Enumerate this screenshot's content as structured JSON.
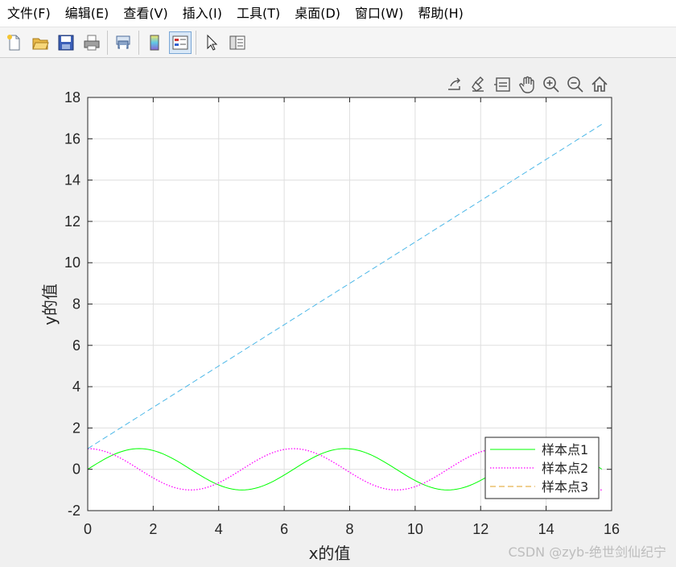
{
  "menu": [
    {
      "label": "文件(F)"
    },
    {
      "label": "编辑(E)"
    },
    {
      "label": "查看(V)"
    },
    {
      "label": "插入(I)"
    },
    {
      "label": "工具(T)"
    },
    {
      "label": "桌面(D)"
    },
    {
      "label": "窗口(W)"
    },
    {
      "label": "帮助(H)"
    }
  ],
  "toolbar": {
    "icons": [
      "new-file-icon",
      "open-folder-icon",
      "save-icon",
      "print-icon",
      "print-preview-icon",
      "colorbar-icon",
      "legend-icon",
      "pointer-icon",
      "property-editor-icon"
    ]
  },
  "axes_toolbar": {
    "icons": [
      "export-icon",
      "brush-icon",
      "data-tips-icon",
      "pan-icon",
      "zoom-in-icon",
      "zoom-out-icon",
      "home-icon"
    ]
  },
  "chart_data": {
    "type": "line",
    "xlabel": "x的值",
    "ylabel": "y的值",
    "xlim": [
      0,
      16
    ],
    "ylim": [
      -2,
      18
    ],
    "xticks": [
      0,
      2,
      4,
      6,
      8,
      10,
      12,
      14,
      16
    ],
    "yticks": [
      -2,
      0,
      2,
      4,
      6,
      8,
      10,
      12,
      14,
      16,
      18
    ],
    "grid": true,
    "legend_position": "bottom-right",
    "x_range": [
      0,
      15.7
    ],
    "series": [
      {
        "name": "样本点1",
        "function": "sin(x)",
        "color": "#00ff00",
        "style": "solid",
        "x": [
          0,
          1.57,
          3.14,
          4.71,
          6.28,
          7.85,
          9.42,
          11.0,
          12.57,
          14.14,
          15.7
        ],
        "y": [
          0,
          1,
          0,
          -1,
          0,
          1,
          0,
          -1,
          0,
          1,
          0
        ]
      },
      {
        "name": "样本点2",
        "function": "cos(x)",
        "color": "#ff00ff",
        "style": "dotted",
        "x": [
          0,
          1.57,
          3.14,
          4.71,
          6.28,
          7.85,
          9.42,
          11.0,
          12.57,
          14.14,
          15.7
        ],
        "y": [
          1,
          0,
          -1,
          0,
          1,
          0,
          -1,
          0,
          1,
          0,
          -1
        ]
      },
      {
        "name": "样本点3",
        "function": "x+1",
        "color": "#4db8e8",
        "style": "dashed",
        "x": [
          0,
          15.7
        ],
        "y": [
          1,
          16.7
        ]
      }
    ],
    "legend_colors": [
      "#00ff00",
      "#ff00ff",
      "#e0a020"
    ]
  },
  "watermark": "CSDN @zyb-绝世剑仙纪宁"
}
